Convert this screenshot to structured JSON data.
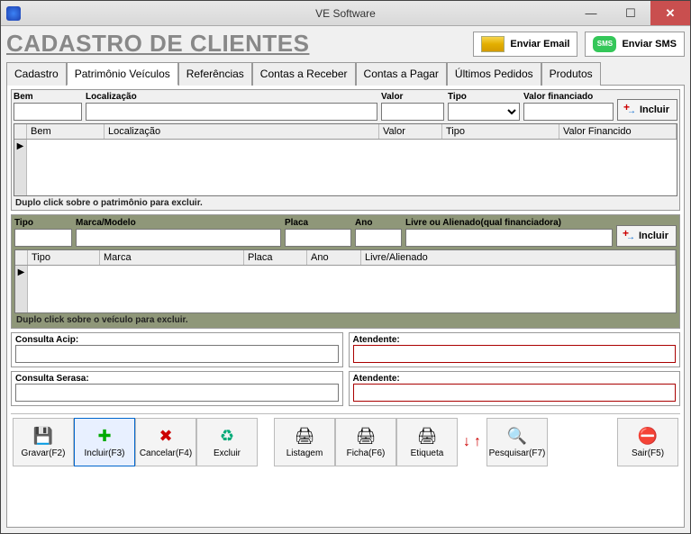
{
  "window": {
    "title": "VE Software"
  },
  "page_title": "CADASTRO DE CLIENTES",
  "actions": {
    "email": "Enviar Email",
    "sms": "Enviar SMS",
    "sms_badge": "SMS"
  },
  "tabs": [
    "Cadastro",
    "Patrimônio Veículos",
    "Referências",
    "Contas a Receber",
    "Contas a Pagar",
    "Últimos Pedidos",
    "Produtos"
  ],
  "active_tab": 1,
  "patr_form": {
    "bem": "Bem",
    "loc": "Localização",
    "valor": "Valor",
    "tipo": "Tipo",
    "valf": "Valor financiado",
    "incluir": "Incluir"
  },
  "patr_grid": {
    "cols": [
      "Bem",
      "Localização",
      "Valor",
      "Tipo",
      "Valor Financido"
    ]
  },
  "patr_hint": "Duplo click  sobre o patrimônio para excluir.",
  "veic_form": {
    "tipo": "Tipo",
    "mm": "Marca/Modelo",
    "placa": "Placa",
    "ano": "Ano",
    "livre": "Livre ou Alienado(qual financiadora)",
    "incluir": "Incluir"
  },
  "veic_grid": {
    "cols": [
      "Tipo",
      "Marca",
      "Placa",
      "Ano",
      "Livre/Alienado"
    ]
  },
  "veic_hint": "Duplo click  sobre o veículo para excluir.",
  "consulta": {
    "acip": "Consulta Acip:",
    "serasa": "Consulta Serasa:",
    "atendente": "Atendente:"
  },
  "toolbar": {
    "gravar": "Gravar(F2)",
    "incluir": "Incluir(F3)",
    "cancelar": "Cancelar(F4)",
    "excluir": "Excluir",
    "listagem": "Listagem",
    "ficha": "Ficha(F6)",
    "etiqueta": "Etiqueta",
    "pesquisar": "Pesquisar(F7)",
    "sair": "Sair(F5)"
  }
}
